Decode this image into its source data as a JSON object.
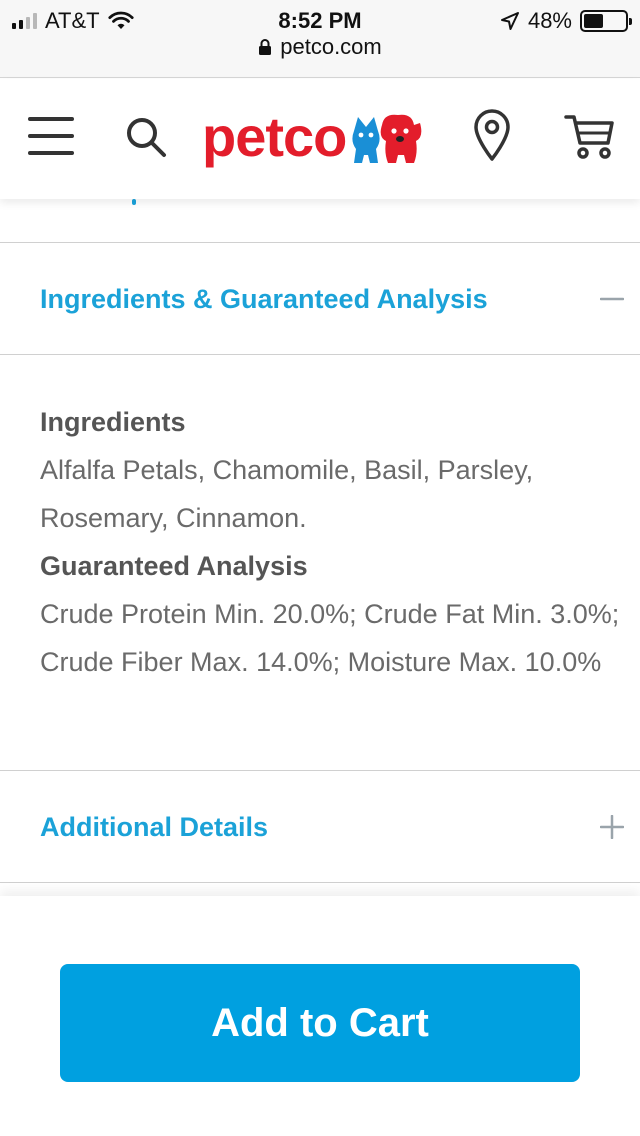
{
  "status_bar": {
    "carrier": "AT&T",
    "time": "8:52 PM",
    "battery_text": "48%",
    "battery_level": 0.48
  },
  "browser": {
    "url": "petco.com"
  },
  "header": {
    "logo_text": "petco",
    "brand_color": "#e31d2b",
    "icons": [
      "hamburger-menu-icon",
      "search-icon",
      "store-locator-icon",
      "cart-icon"
    ]
  },
  "accordion": {
    "ingredients_section": {
      "title": "Ingredients & Guaranteed Analysis",
      "expanded": true,
      "ingredients_heading": "Ingredients",
      "ingredients_text": "Alfalfa Petals, Chamomile, Basil, Parsley, Rosemary, Cinnamon.",
      "analysis_heading": "Guaranteed Analysis",
      "analysis_text": "Crude Protein Min. 20.0%; Crude Fat Min. 3.0%; Crude Fiber Max. 14.0%; Moisture Max. 10.0%"
    },
    "additional_section": {
      "title": "Additional Details",
      "expanded": false
    },
    "accent_color": "#1ba2d8"
  },
  "actions": {
    "add_to_cart_label": "Add to Cart",
    "button_color": "#00a0e0"
  }
}
